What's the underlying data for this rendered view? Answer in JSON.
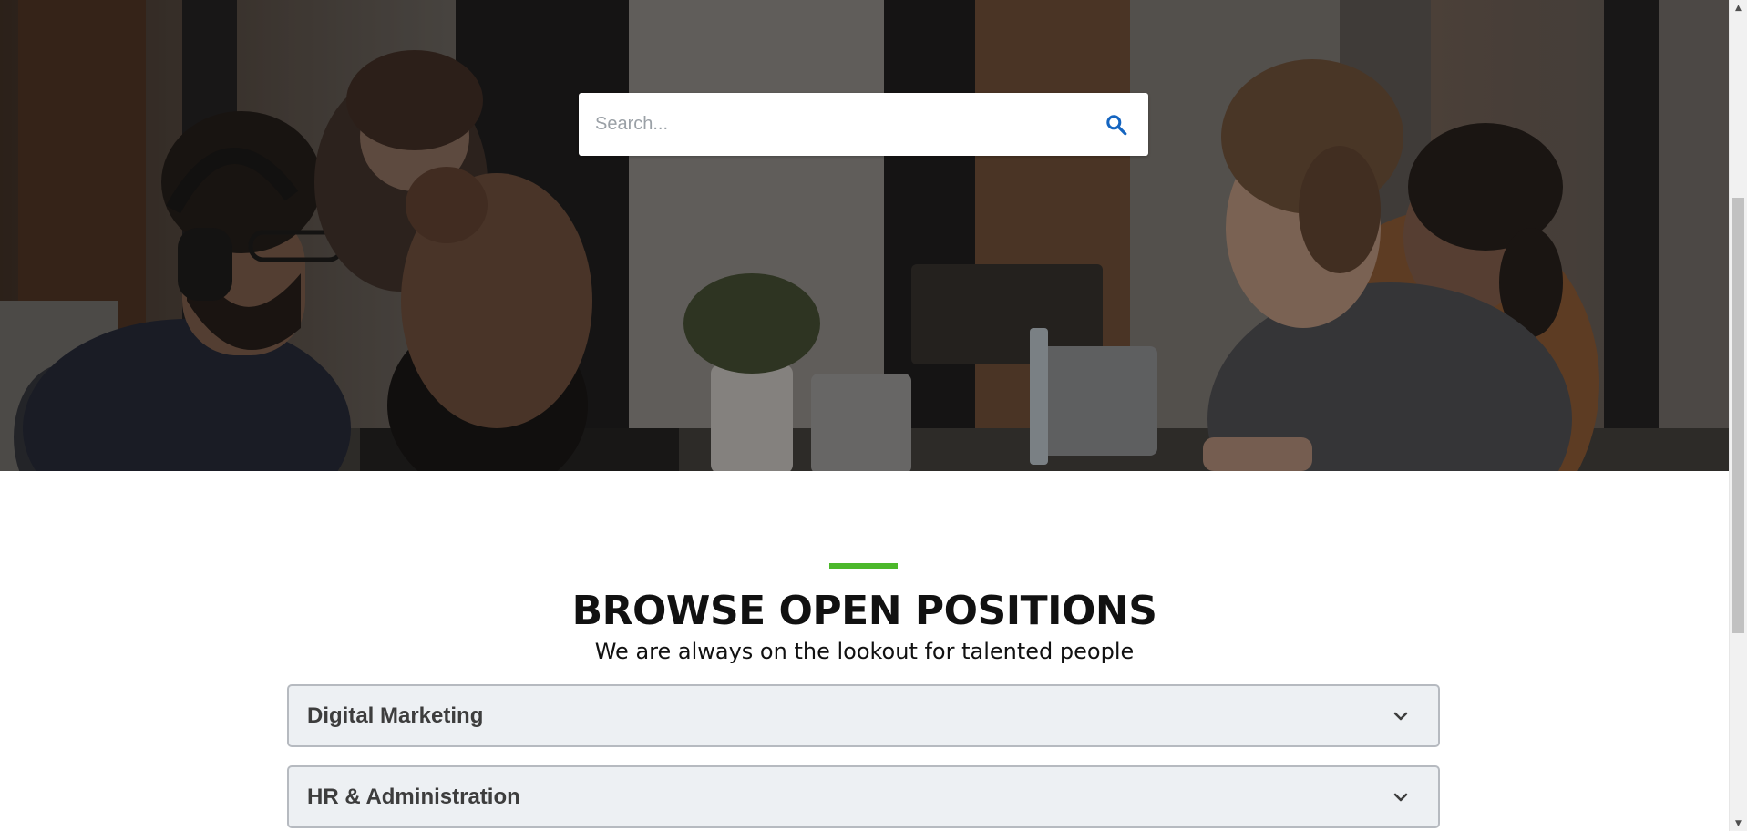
{
  "search": {
    "placeholder": "Search...",
    "value": "",
    "icon": "search-icon"
  },
  "section": {
    "title": "BROWSE OPEN POSITIONS",
    "subtitle": "We are always on the lookout for talented people",
    "accent_color": "#4cb82b"
  },
  "accordion": {
    "items": [
      {
        "label": "Digital Marketing",
        "icon": "chevron-down-icon"
      },
      {
        "label": "HR & Administration",
        "icon": "chevron-down-icon"
      }
    ]
  },
  "scrollbar": {
    "up_glyph": "▲",
    "down_glyph": "▼"
  },
  "colors": {
    "search_icon": "#1565c0",
    "title": "#111111",
    "accordion_bg": "#edf0f3",
    "accordion_border": "#b6bac0"
  }
}
